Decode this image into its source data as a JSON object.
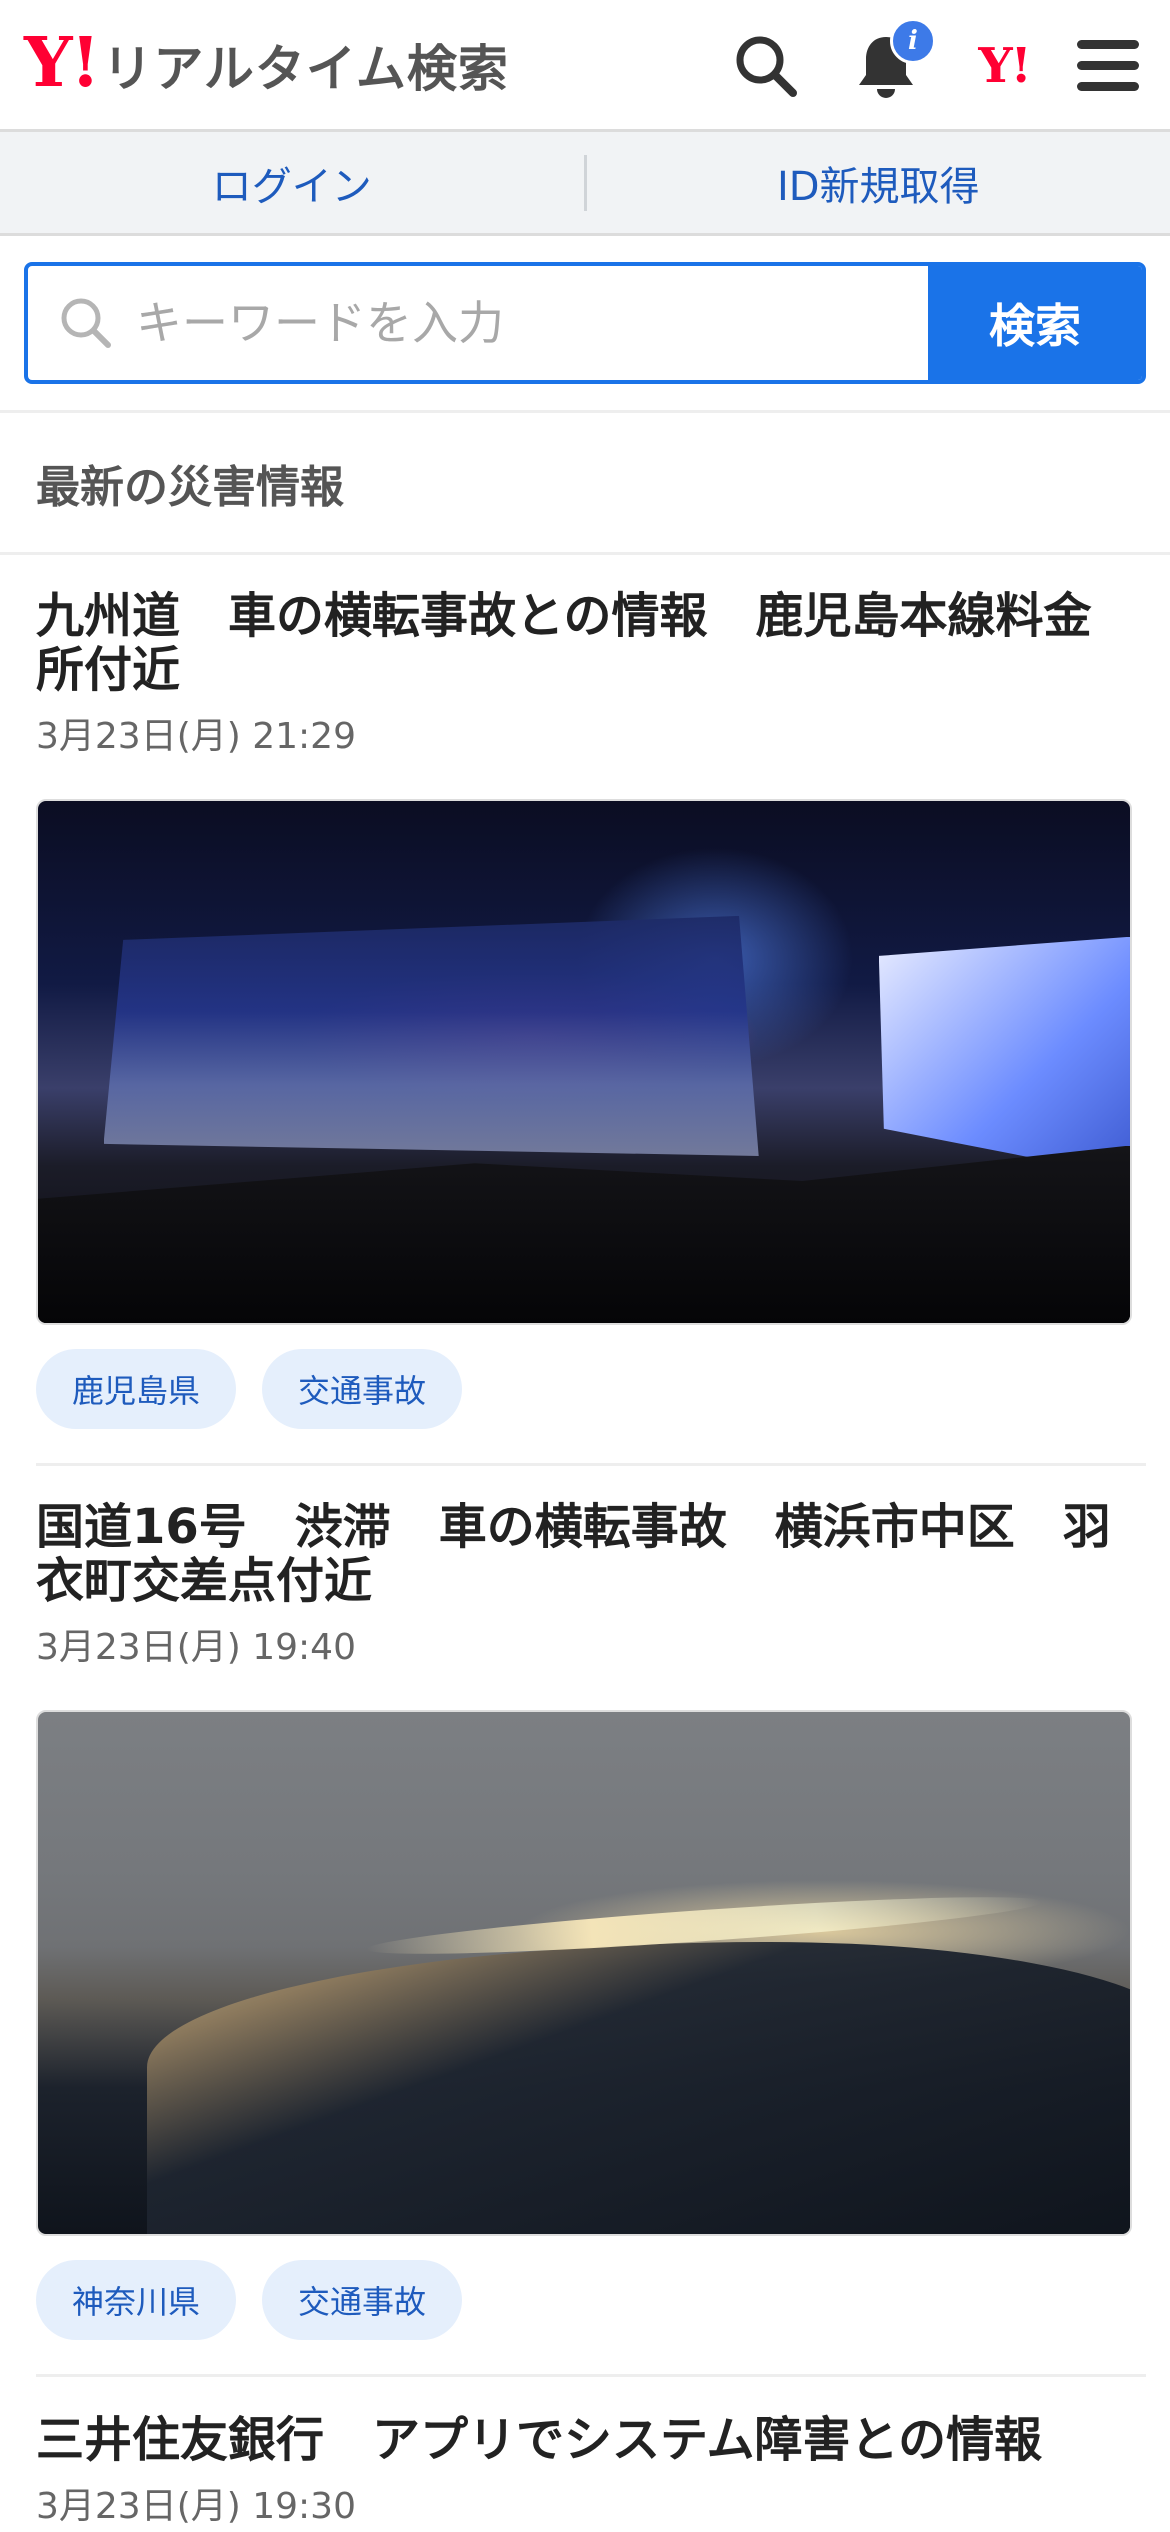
{
  "header": {
    "logo_mark": "Y!",
    "logo_text": "リアルタイム検索",
    "notification_badge": "i",
    "yahoo_logo": "Y!"
  },
  "login_bar": {
    "login": "ログイン",
    "signup": "ID新規取得"
  },
  "search": {
    "placeholder": "キーワードを入力",
    "button": "検索"
  },
  "section": {
    "title": "最新の災害情報"
  },
  "articles": [
    {
      "title": "九州道　車の横転事故との情報　鹿児島本線料金所付近",
      "time": "3月23日(月) 21:29",
      "tags": [
        "鹿児島県",
        "交通事故"
      ]
    },
    {
      "title": "国道16号　渋滞　車の横転事故　横浜市中区　羽衣町交差点付近",
      "time": "3月23日(月) 19:40",
      "tags": [
        "神奈川県",
        "交通事故"
      ]
    },
    {
      "title": "三井住友銀行　アプリでシステム障害との情報",
      "time": "3月23日(月) 19:30"
    }
  ],
  "colors": {
    "brand_red": "#ff0033",
    "accent_blue": "#1a73e8",
    "link_blue": "#1e5bbd",
    "tag_bg": "#e5effc"
  }
}
